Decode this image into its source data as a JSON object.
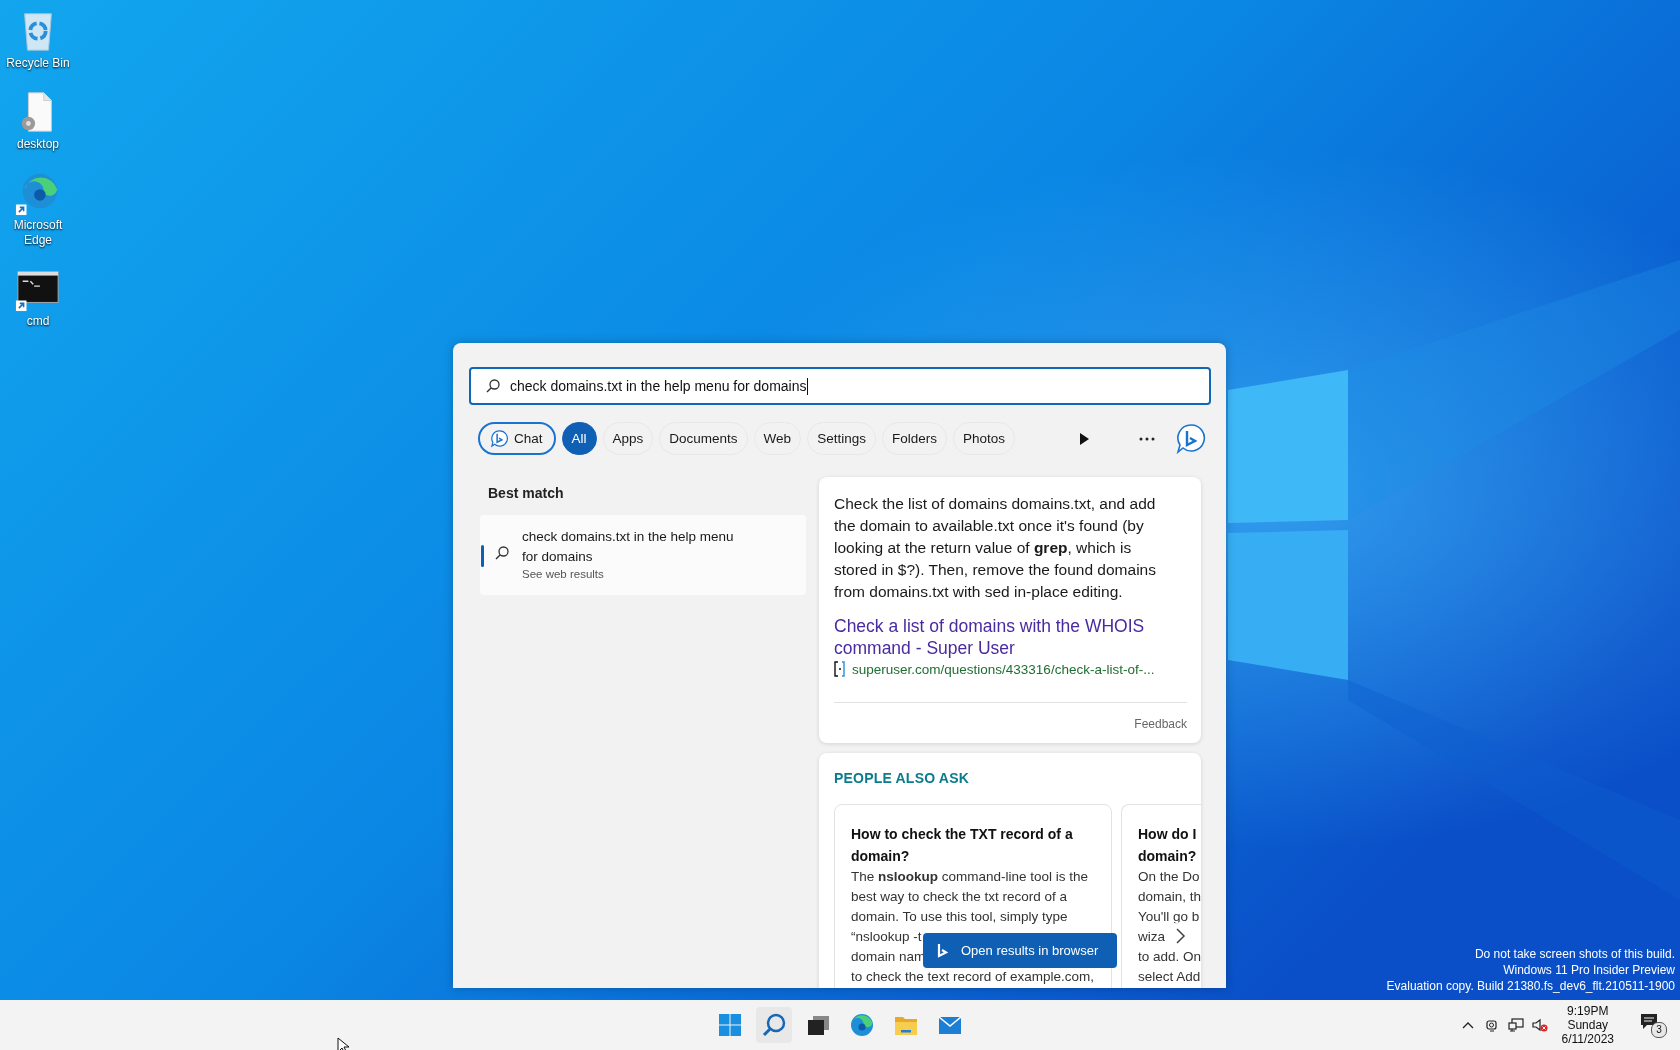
{
  "desktop": {
    "icons": [
      {
        "label": "Recycle Bin",
        "kind": "recycle",
        "shortcut": false
      },
      {
        "label": "desktop",
        "kind": "file",
        "shortcut": false
      },
      {
        "label": "Microsoft Edge",
        "kind": "edge",
        "shortcut": true
      },
      {
        "label": "cmd",
        "kind": "cmd",
        "shortcut": true
      }
    ],
    "watermark": [
      "Do not take screen shots of this build.",
      "Windows 11 Pro Insider Preview",
      "Evaluation copy. Build 21380.fs_dev6_flt.210511-1900"
    ]
  },
  "search": {
    "query": "check domains.txt in the help menu for domains",
    "filters": [
      {
        "label": "Chat",
        "kind": "chat",
        "selected": false
      },
      {
        "label": "All",
        "kind": "text",
        "selected": true
      },
      {
        "label": "Apps",
        "kind": "text",
        "selected": false
      },
      {
        "label": "Documents",
        "kind": "text",
        "selected": false
      },
      {
        "label": "Web",
        "kind": "text",
        "selected": false
      },
      {
        "label": "Settings",
        "kind": "text",
        "selected": false
      },
      {
        "label": "Folders",
        "kind": "text",
        "selected": false
      },
      {
        "label": "Photos",
        "kind": "text",
        "selected": false
      }
    ],
    "best_match": {
      "heading": "Best match",
      "title": "check domains.txt in the help menu for domains",
      "subtitle": "See web results",
      "selected": true
    },
    "answer": {
      "text": "Check the list of domains domains.txt, and add the domain to available.txt once it's found (by looking at the return value of **grep**, which is stored in $?). Then, remove the found domains from domains.txt with sed in-place editing.",
      "link": "Check a list of domains with the WHOIS command - Super User",
      "url": "superuser.com/questions/433316/check-a-list-of-...",
      "feedback": "Feedback"
    },
    "people_also_ask": {
      "heading": "PEOPLE ALSO ASK",
      "cards": [
        {
          "question_lines": [
            "How to check the TXT record of a",
            "domain?"
          ],
          "body_lines": [
            "The **nslookup** command-line tool is the",
            "best way to check the txt record of a",
            "domain. To use this tool, simply type",
            "“nslookup -t",
            "domain nam",
            "to check the text record of example.com,"
          ]
        },
        {
          "question_lines": [
            "How do I",
            "domain?"
          ],
          "body_lines": [
            "On the Do",
            "domain, th",
            "You'll go b",
            "wiza",
            "to add. On",
            "select Add"
          ]
        }
      ]
    },
    "open_button": "Open results in browser"
  },
  "taskbar": {
    "apps": [
      {
        "kind": "start"
      },
      {
        "kind": "search"
      },
      {
        "kind": "taskview"
      },
      {
        "kind": "edge"
      },
      {
        "kind": "explorer"
      },
      {
        "kind": "mail"
      }
    ],
    "clock": {
      "time": "9:19PM",
      "day": "Sunday",
      "date": "6/11/2023"
    },
    "notifications": "3"
  }
}
